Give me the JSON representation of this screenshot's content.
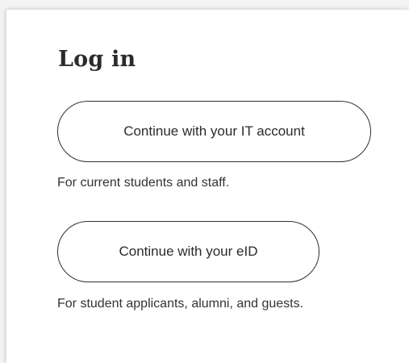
{
  "login": {
    "title": "Log in",
    "it_account_button": "Continue with your IT account",
    "it_account_note": "For current students and staff.",
    "eid_button": "Continue with your eID",
    "eid_note": "For student applicants, alumni, and guests."
  },
  "colors": {
    "text": "#2b2b2b",
    "button_border": "#2f2f2f",
    "background": "#ffffff"
  }
}
